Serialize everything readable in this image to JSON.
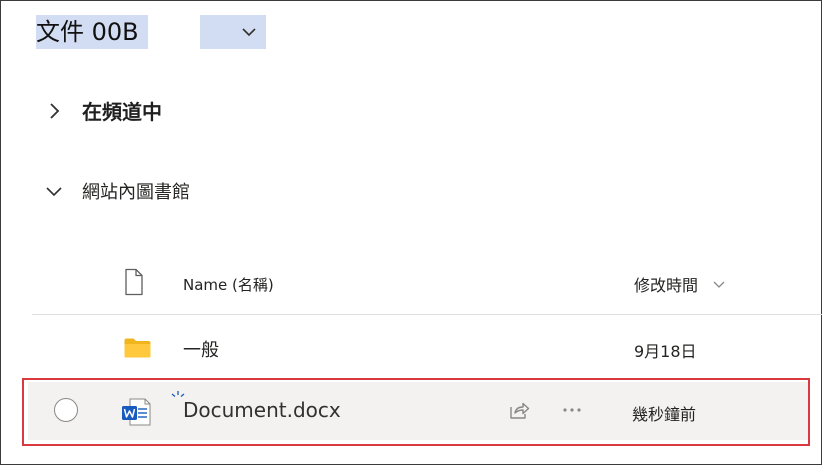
{
  "header": {
    "title": "文件 00B"
  },
  "sections": {
    "in_channel": "在頻道中",
    "site_libraries": "網站內圖書館"
  },
  "columns": {
    "name": "Name (名稱)",
    "modified": "修改時間"
  },
  "rows": [
    {
      "type": "folder",
      "name": "一般",
      "modified": "9月18日"
    },
    {
      "type": "word-document",
      "name": "Document.docx",
      "modified": "幾秒鐘前"
    }
  ],
  "colors": {
    "title_highlight": "#d2dcf2",
    "folder": "#f0b41c",
    "word_blue": "#185abd",
    "callout_red": "#d9393f",
    "selected_row_bg": "#f3f2f1"
  },
  "icons": {
    "title_dropdown": "chevron-down-icon",
    "section_collapsed": "chevron-right-icon",
    "section_expanded": "chevron-down-icon",
    "file_type_header": "document-icon",
    "folder": "folder-icon",
    "word_document": "word-document-icon",
    "new_badge": "sparkle-icon",
    "share": "share-icon",
    "more": "more-options-icon",
    "select": "radio-circle-icon"
  }
}
